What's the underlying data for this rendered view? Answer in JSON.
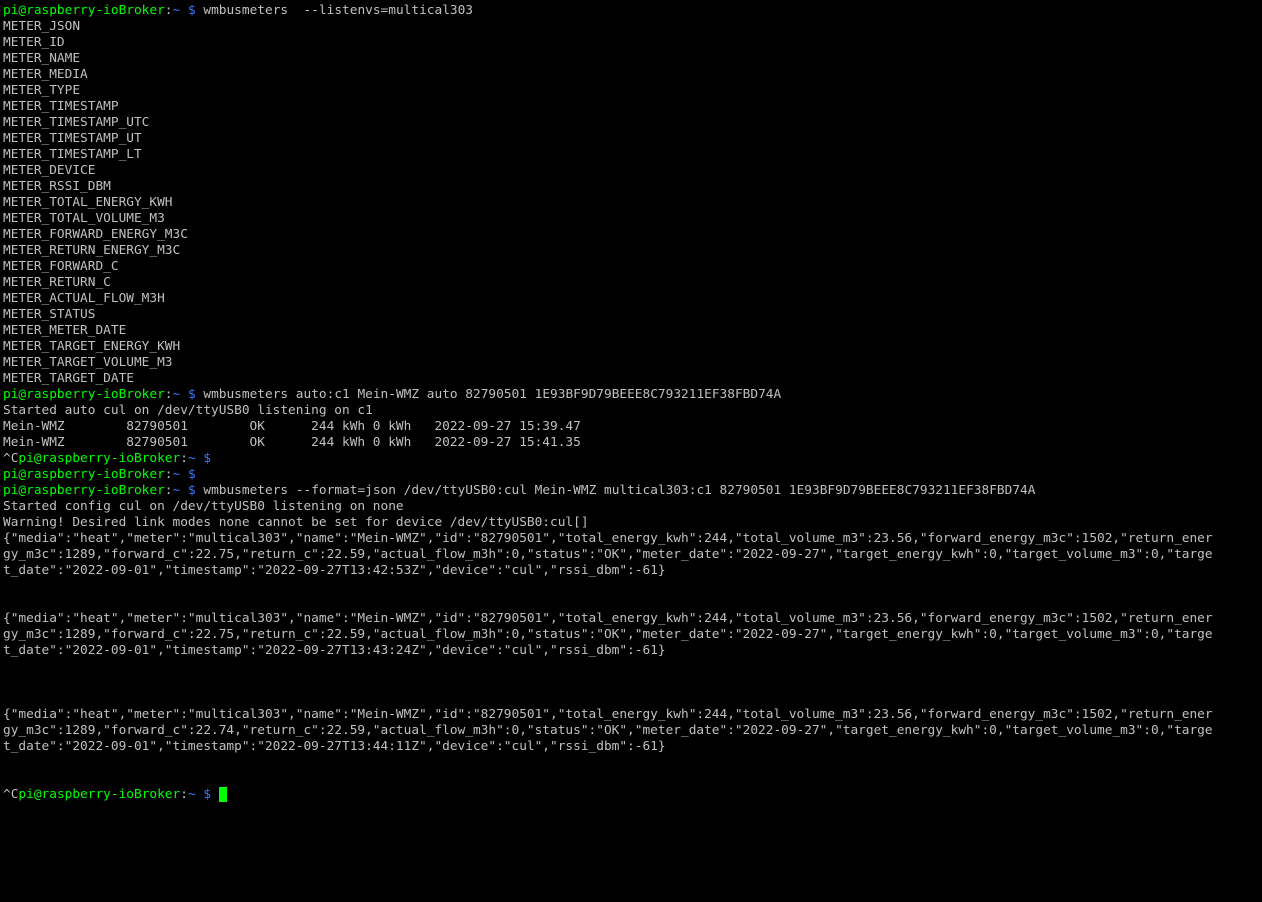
{
  "colors": {
    "background": "#000000",
    "output_text": "#c0c0c0",
    "prompt_user": "#00ff00",
    "prompt_path": "#3b78ff",
    "cursor": "#00ff00"
  },
  "terminal": {
    "lines": [
      {
        "kind": "prompt",
        "prefix": "",
        "user": "pi@raspberry-ioBroker",
        "path": "~",
        "cmd": "wmbusmeters  --listenvs=multical303"
      },
      {
        "kind": "output",
        "text": "METER_JSON"
      },
      {
        "kind": "output",
        "text": "METER_ID"
      },
      {
        "kind": "output",
        "text": "METER_NAME"
      },
      {
        "kind": "output",
        "text": "METER_MEDIA"
      },
      {
        "kind": "output",
        "text": "METER_TYPE"
      },
      {
        "kind": "output",
        "text": "METER_TIMESTAMP"
      },
      {
        "kind": "output",
        "text": "METER_TIMESTAMP_UTC"
      },
      {
        "kind": "output",
        "text": "METER_TIMESTAMP_UT"
      },
      {
        "kind": "output",
        "text": "METER_TIMESTAMP_LT"
      },
      {
        "kind": "output",
        "text": "METER_DEVICE"
      },
      {
        "kind": "output",
        "text": "METER_RSSI_DBM"
      },
      {
        "kind": "output",
        "text": "METER_TOTAL_ENERGY_KWH"
      },
      {
        "kind": "output",
        "text": "METER_TOTAL_VOLUME_M3"
      },
      {
        "kind": "output",
        "text": "METER_FORWARD_ENERGY_M3C"
      },
      {
        "kind": "output",
        "text": "METER_RETURN_ENERGY_M3C"
      },
      {
        "kind": "output",
        "text": "METER_FORWARD_C"
      },
      {
        "kind": "output",
        "text": "METER_RETURN_C"
      },
      {
        "kind": "output",
        "text": "METER_ACTUAL_FLOW_M3H"
      },
      {
        "kind": "output",
        "text": "METER_STATUS"
      },
      {
        "kind": "output",
        "text": "METER_METER_DATE"
      },
      {
        "kind": "output",
        "text": "METER_TARGET_ENERGY_KWH"
      },
      {
        "kind": "output",
        "text": "METER_TARGET_VOLUME_M3"
      },
      {
        "kind": "output",
        "text": "METER_TARGET_DATE"
      },
      {
        "kind": "prompt",
        "prefix": "",
        "user": "pi@raspberry-ioBroker",
        "path": "~",
        "cmd": "wmbusmeters auto:c1 Mein-WMZ auto 82790501 1E93BF9D79BEEE8C793211EF38FBD74A"
      },
      {
        "kind": "output",
        "text": "Started auto cul on /dev/ttyUSB0 listening on c1"
      },
      {
        "kind": "output",
        "text": "Mein-WMZ        82790501        OK      244 kWh 0 kWh   2022-09-27 15:39.47"
      },
      {
        "kind": "output",
        "text": "Mein-WMZ        82790501        OK      244 kWh 0 kWh   2022-09-27 15:41.35"
      },
      {
        "kind": "prompt",
        "prefix": "^C",
        "user": "pi@raspberry-ioBroker",
        "path": "~",
        "cmd": ""
      },
      {
        "kind": "prompt",
        "prefix": "",
        "user": "pi@raspberry-ioBroker",
        "path": "~",
        "cmd": ""
      },
      {
        "kind": "prompt",
        "prefix": "",
        "user": "pi@raspberry-ioBroker",
        "path": "~",
        "cmd": "wmbusmeters --format=json /dev/ttyUSB0:cul Mein-WMZ multical303:c1 82790501 1E93BF9D79BEEE8C793211EF38FBD74A"
      },
      {
        "kind": "output",
        "text": "Started config cul on /dev/ttyUSB0 listening on none"
      },
      {
        "kind": "output",
        "text": "Warning! Desired link modes none cannot be set for device /dev/ttyUSB0:cul[]"
      },
      {
        "kind": "output",
        "text": "{\"media\":\"heat\",\"meter\":\"multical303\",\"name\":\"Mein-WMZ\",\"id\":\"82790501\",\"total_energy_kwh\":244,\"total_volume_m3\":23.56,\"forward_energy_m3c\":1502,\"return_ener"
      },
      {
        "kind": "output",
        "text": "gy_m3c\":1289,\"forward_c\":22.75,\"return_c\":22.59,\"actual_flow_m3h\":0,\"status\":\"OK\",\"meter_date\":\"2022-09-27\",\"target_energy_kwh\":0,\"target_volume_m3\":0,\"targe"
      },
      {
        "kind": "output",
        "text": "t_date\":\"2022-09-01\",\"timestamp\":\"2022-09-27T13:42:53Z\",\"device\":\"cul\",\"rssi_dbm\":-61}"
      },
      {
        "kind": "output",
        "text": ""
      },
      {
        "kind": "output",
        "text": ""
      },
      {
        "kind": "output",
        "text": "{\"media\":\"heat\",\"meter\":\"multical303\",\"name\":\"Mein-WMZ\",\"id\":\"82790501\",\"total_energy_kwh\":244,\"total_volume_m3\":23.56,\"forward_energy_m3c\":1502,\"return_ener"
      },
      {
        "kind": "output",
        "text": "gy_m3c\":1289,\"forward_c\":22.75,\"return_c\":22.59,\"actual_flow_m3h\":0,\"status\":\"OK\",\"meter_date\":\"2022-09-27\",\"target_energy_kwh\":0,\"target_volume_m3\":0,\"targe"
      },
      {
        "kind": "output",
        "text": "t_date\":\"2022-09-01\",\"timestamp\":\"2022-09-27T13:43:24Z\",\"device\":\"cul\",\"rssi_dbm\":-61}"
      },
      {
        "kind": "output",
        "text": ""
      },
      {
        "kind": "output",
        "text": ""
      },
      {
        "kind": "output",
        "text": ""
      },
      {
        "kind": "output",
        "text": "{\"media\":\"heat\",\"meter\":\"multical303\",\"name\":\"Mein-WMZ\",\"id\":\"82790501\",\"total_energy_kwh\":244,\"total_volume_m3\":23.56,\"forward_energy_m3c\":1502,\"return_ener"
      },
      {
        "kind": "output",
        "text": "gy_m3c\":1289,\"forward_c\":22.74,\"return_c\":22.59,\"actual_flow_m3h\":0,\"status\":\"OK\",\"meter_date\":\"2022-09-27\",\"target_energy_kwh\":0,\"target_volume_m3\":0,\"targe"
      },
      {
        "kind": "output",
        "text": "t_date\":\"2022-09-01\",\"timestamp\":\"2022-09-27T13:44:11Z\",\"device\":\"cul\",\"rssi_dbm\":-61}"
      },
      {
        "kind": "output",
        "text": ""
      },
      {
        "kind": "output",
        "text": ""
      },
      {
        "kind": "prompt",
        "prefix": "^C",
        "user": "pi@raspberry-ioBroker",
        "path": "~",
        "cmd": "",
        "cursor": true
      }
    ]
  }
}
